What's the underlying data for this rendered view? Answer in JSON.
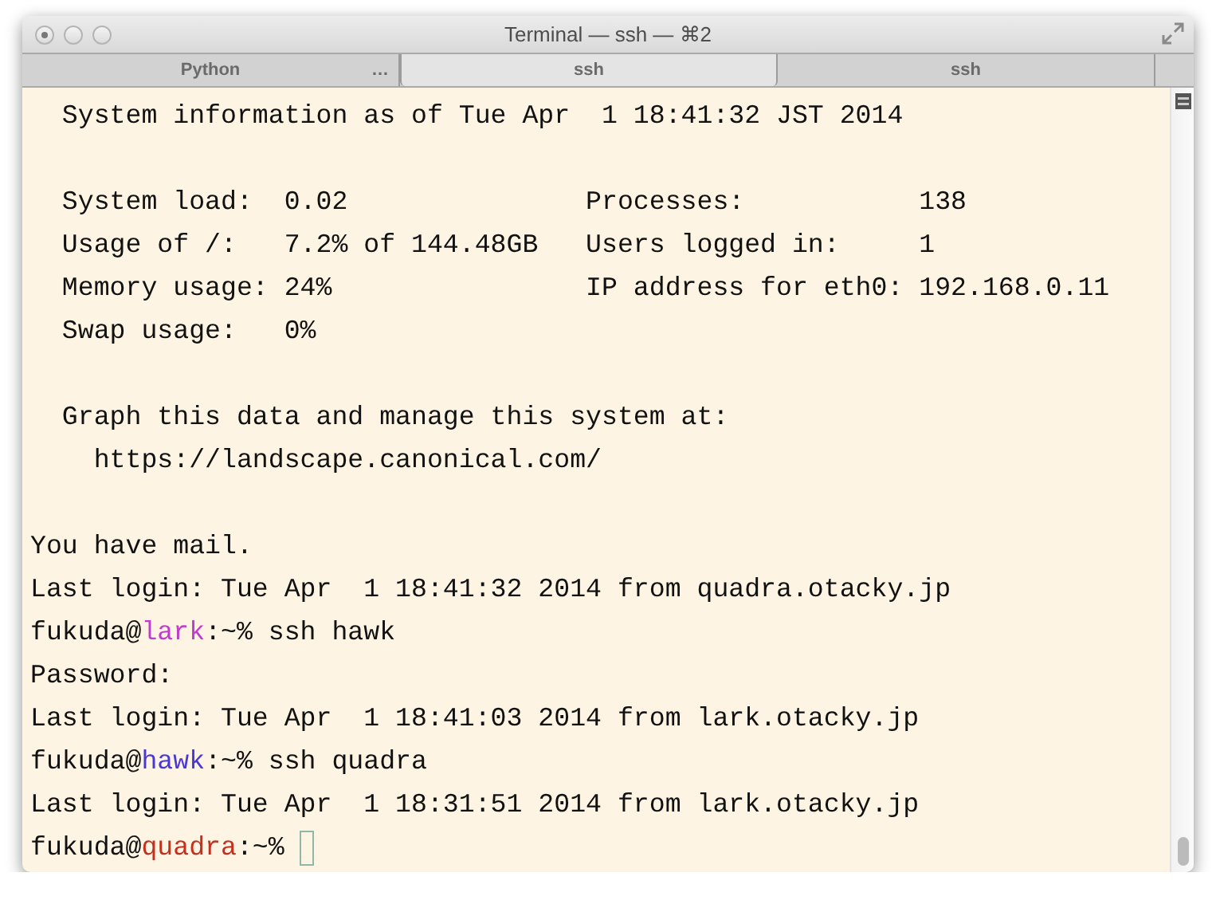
{
  "window": {
    "title": "Terminal — ssh — ⌘2"
  },
  "tabs": [
    {
      "label": "Python",
      "selected": false,
      "activity": "…"
    },
    {
      "label": "ssh",
      "selected": true
    },
    {
      "label": "ssh",
      "selected": false
    }
  ],
  "terminal": {
    "lines": [
      {
        "kind": "text",
        "text": "  System information as of Tue Apr  1 18:41:32 JST 2014"
      },
      {
        "kind": "blank"
      },
      {
        "kind": "text",
        "text": "  System load:  0.02               Processes:           138"
      },
      {
        "kind": "text",
        "text": "  Usage of /:   7.2% of 144.48GB   Users logged in:     1"
      },
      {
        "kind": "text",
        "text": "  Memory usage: 24%                IP address for eth0: 192.168.0.11"
      },
      {
        "kind": "text",
        "text": "  Swap usage:   0%"
      },
      {
        "kind": "blank"
      },
      {
        "kind": "text",
        "text": "  Graph this data and manage this system at:"
      },
      {
        "kind": "text",
        "text": "    https://landscape.canonical.com/"
      },
      {
        "kind": "blank"
      },
      {
        "kind": "text",
        "text": "You have mail."
      },
      {
        "kind": "text",
        "text": "Last login: Tue Apr  1 18:41:32 2014 from quadra.otacky.jp"
      },
      {
        "kind": "prompt",
        "user": "fukuda@",
        "host": "lark",
        "color": "#c03ccc",
        "rest": ":~% ssh hawk"
      },
      {
        "kind": "text",
        "text": "Password:"
      },
      {
        "kind": "text",
        "text": "Last login: Tue Apr  1 18:41:03 2014 from lark.otacky.jp"
      },
      {
        "kind": "prompt",
        "user": "fukuda@",
        "host": "hawk",
        "color": "#4a38d4",
        "rest": ":~% ssh quadra"
      },
      {
        "kind": "text",
        "text": "Last login: Tue Apr  1 18:31:51 2014 from lark.otacky.jp"
      },
      {
        "kind": "prompt",
        "user": "fukuda@",
        "host": "quadra",
        "color": "#c3301e",
        "rest": ":~% ",
        "cursor": true
      }
    ]
  }
}
